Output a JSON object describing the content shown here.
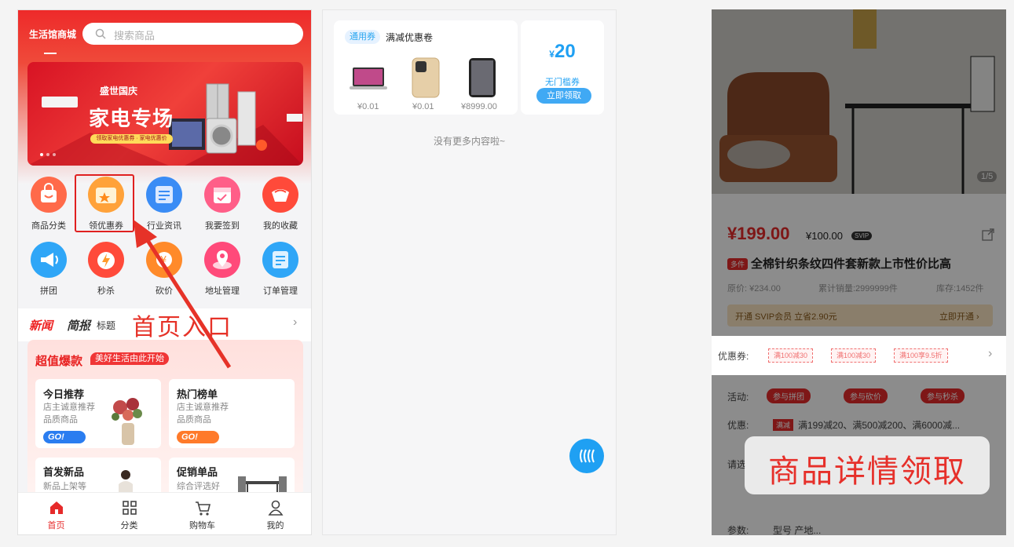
{
  "home": {
    "store_name": "生活馆商城",
    "search_placeholder": "搜索商品",
    "banner": {
      "title": "家电专场",
      "subtitle": "盛世国庆",
      "tag": "领取家电优惠券 · 家电优惠价"
    },
    "grid": [
      {
        "label": "商品分类",
        "icon": "shopping-bag-icon",
        "color": "#ff6a4a"
      },
      {
        "label": "领优惠券",
        "icon": "coupon-icon",
        "color": "#ffa23a"
      },
      {
        "label": "行业资讯",
        "icon": "news-icon",
        "color": "#3a8cf5"
      },
      {
        "label": "我要签到",
        "icon": "calendar-icon",
        "color": "#ff5e88"
      },
      {
        "label": "我的收藏",
        "icon": "collection-icon",
        "color": "#ff4a3a"
      },
      {
        "label": "拼团",
        "icon": "megaphone-icon",
        "color": "#2fa6f7"
      },
      {
        "label": "秒杀",
        "icon": "flash-sale-icon",
        "color": "#ff4a3a"
      },
      {
        "label": "砍价",
        "icon": "bargain-icon",
        "color": "#ff8a2a"
      },
      {
        "label": "地址管理",
        "icon": "address-icon",
        "color": "#ff4a7a"
      },
      {
        "label": "订单管理",
        "icon": "order-icon",
        "color": "#2fa6f7"
      }
    ],
    "news": {
      "title_red": "新闻",
      "title_dark": "简报",
      "tag": "标题",
      "arrow": "›"
    },
    "deal": {
      "title": "超值爆款",
      "badge": "美好生活由此开始",
      "cards": [
        {
          "title": "今日推荐",
          "desc": "店主诚意推荐 品质商品",
          "go": "GO!"
        },
        {
          "title": "热门榜单",
          "desc": "店主诚意推荐 品质商品",
          "go": "GO!"
        },
        {
          "title": "首发新品",
          "desc": "新品上架等"
        },
        {
          "title": "促销单品",
          "desc": "综合评选好"
        }
      ]
    },
    "tabs": [
      {
        "label": "首页"
      },
      {
        "label": "分类"
      },
      {
        "label": "购物车"
      },
      {
        "label": "我的"
      }
    ],
    "accent": "#e62a2a"
  },
  "annotation_home": "首页入口",
  "coupon_page": {
    "tag": "通用券",
    "title": "满减优惠卷",
    "products": [
      {
        "price": "¥0.01"
      },
      {
        "price": "¥0.01"
      },
      {
        "price": "¥8999.00"
      }
    ],
    "amount_symbol": "¥",
    "amount": "20",
    "condition": "无门槛券",
    "claim": "立即领取",
    "no_more": "没有更多内容啦~"
  },
  "detail": {
    "image_counter": "1/5",
    "price": "¥199.00",
    "vip_price": "¥100.00",
    "vip_badge": "SVIP",
    "tag": "多件",
    "name": "全棉针织条纹四件套新款上市性价比高",
    "orig_price": "原价: ¥234.00",
    "sales": "累计销量:2999999件",
    "stock": "库存:1452件",
    "svip_bar": "开通 SVIP会员 立省2.90元",
    "svip_open": "立即开通 ›",
    "coupon_label": "优惠券:",
    "coupons": [
      "满100减30",
      "满100减30",
      "满100享9.5折"
    ],
    "activity_label": "活动:",
    "activities": [
      "参与拼团",
      "参与砍价",
      "参与秒杀"
    ],
    "promo_label": "优惠:",
    "promo_tag": "满减",
    "promo_text": "满199减20、满500减200、满6000减...",
    "select_label": "请选",
    "param_label": "参数:",
    "param_text": "型号 产地...",
    "overlay_text": "商品详情领取"
  }
}
